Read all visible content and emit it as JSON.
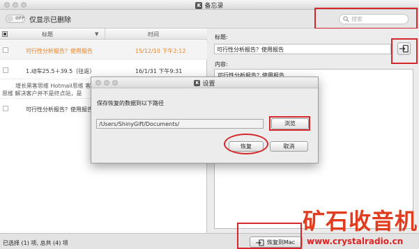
{
  "window": {
    "title": "备忘录"
  },
  "toolbar": {
    "toggle_label": "OFF",
    "filter_label": "仅显示已删除",
    "search_placeholder": "搜索"
  },
  "list": {
    "columns": {
      "title": "标题",
      "time": "时间"
    },
    "rows": [
      {
        "title": "可行性分析报告？使用报告",
        "time": "15/12/10 下午2:12",
        "selected": true
      },
      {
        "title": "1.动车25.5＋39.5（往返）",
        "time": "16/1/31 下午9:31",
        "selected": false
      },
      {
        "title_lines": [
          "增长黑客思维 Hotmail思维 客服",
          "思维 解决客户并不是终点站，是"
        ],
        "selected": false
      },
      {
        "title": "可行性分析报告？使用报告",
        "selected": false
      }
    ]
  },
  "editor": {
    "title_label": "标题:",
    "title_value": "可行性分析报告？使用报告",
    "content_label": "内容:",
    "content_value": "可行性分析报告？使用报告"
  },
  "status": {
    "text": "已选择 (1) 项, 总共 (4) 项",
    "restore_to_mac": "恢复到Mac"
  },
  "dialog": {
    "title": "设置",
    "heading": "保存恢复的数据到以下路径",
    "path": "/Users/ShinyGift/Documents/",
    "browse": "浏览",
    "restore": "恢复",
    "cancel": "取消"
  },
  "watermark": {
    "chinese": "矿石收音机",
    "url": "www.crystalradio.cn"
  },
  "colors": {
    "accent_selected": "#e5842b",
    "annotation_red": "#d4262b",
    "watermark_red": "#e03c1d"
  }
}
